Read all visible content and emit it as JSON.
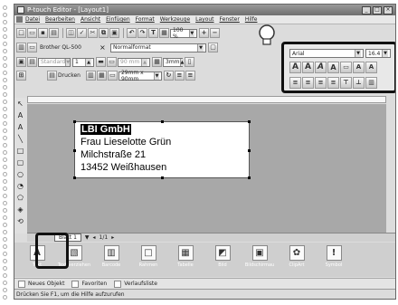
{
  "window": {
    "title": "P-touch Editor - [Layout1]",
    "min": "_",
    "max": "□",
    "close": "×"
  },
  "menu": [
    "Datei",
    "Bearbeiten",
    "Ansicht",
    "Einfügen",
    "Format",
    "Werkzeuge",
    "Layout",
    "Fenster",
    "Hilfe"
  ],
  "toolbar": {
    "zoom": "100 %",
    "text_tool": "T"
  },
  "printer": {
    "model": "Brother QL-500",
    "print_label": "Drucken"
  },
  "props": {
    "paper_format": "Normalformat",
    "font": "Standard",
    "size_value": "1",
    "length": "90 mm",
    "margin": "3mm",
    "tape": "29mm x 90mm"
  },
  "font_panel": {
    "font": "Arial",
    "size": "16.4"
  },
  "label_lines": [
    "LBI GmbH",
    "Frau Lieselotte Grün",
    "Milchstraße 21",
    "13452 Weißhausen"
  ],
  "sheet": {
    "tab": "Blatt 1",
    "pages": "1/1"
  },
  "objects": [
    "Text",
    "Text verziehen",
    "Barcode",
    "Rahmen",
    "Tabelle",
    "Bild",
    "Bildschirmau",
    "ClipArt",
    "Symbol"
  ],
  "bottom": {
    "new_object": "Neues Objekt",
    "favorites": "Favoriten",
    "history": "Verlaufsliste"
  },
  "status": "Drücken Sie F1, um die Hilfe aufzurufen"
}
